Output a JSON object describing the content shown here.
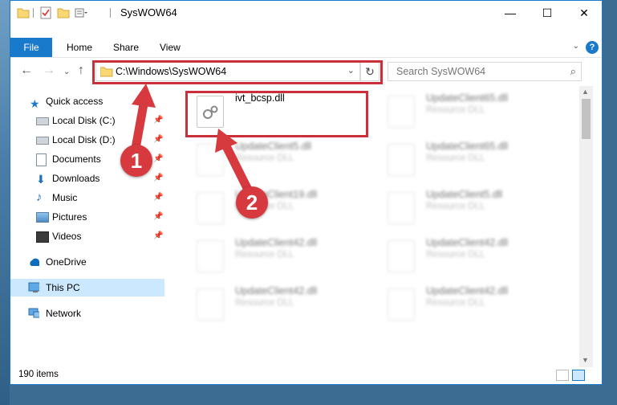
{
  "window": {
    "title": "SysWOW64",
    "controls": {
      "minimize": "—",
      "maximize": "☐",
      "close": "✕"
    }
  },
  "ribbon": {
    "file_tab": "File",
    "tabs": [
      "Home",
      "Share",
      "View"
    ],
    "help": "?"
  },
  "address": {
    "path": "C:\\Windows\\SysWOW64",
    "search_placeholder": "Search SysWOW64"
  },
  "nav": {
    "quick_access": "Quick access",
    "pinned": [
      {
        "label": "Local Disk (C:)",
        "icon": "drive-icon"
      },
      {
        "label": "Local Disk (D:)",
        "icon": "drive-icon"
      },
      {
        "label": "Documents",
        "icon": "documents-icon"
      },
      {
        "label": "Downloads",
        "icon": "downloads-icon"
      },
      {
        "label": "Music",
        "icon": "music-icon"
      },
      {
        "label": "Pictures",
        "icon": "pictures-icon"
      },
      {
        "label": "Videos",
        "icon": "videos-icon"
      }
    ],
    "onedrive": "OneDrive",
    "this_pc": "This PC",
    "network": "Network"
  },
  "files": [
    {
      "name": "ivt_bcsp.dll",
      "type": ""
    },
    {
      "name": "UpdateClient65.dll",
      "type": "Resource DLL"
    },
    {
      "name": "UpdateClient5.dll",
      "type": "Resource DLL"
    },
    {
      "name": "UpdateClient65.dll",
      "type": "Resource DLL"
    },
    {
      "name": "UpdateClient19.dll",
      "type": "Resource DLL"
    },
    {
      "name": "UpdateClient5.dll",
      "type": "Resource DLL"
    },
    {
      "name": "UpdateClient42.dll",
      "type": "Resource DLL"
    },
    {
      "name": "UpdateClient42.dll",
      "type": "Resource DLL"
    },
    {
      "name": "UpdateClient42.dll",
      "type": "Resource DLL"
    },
    {
      "name": "UpdateClient42.dll",
      "type": "Resource DLL"
    }
  ],
  "status": {
    "item_count": "190 items"
  },
  "callouts": [
    "1",
    "2"
  ],
  "colors": {
    "accent": "#1979ca",
    "callout": "#d63a3f",
    "highlight_box": "#c9303a",
    "selected_nav": "#cce8ff"
  }
}
